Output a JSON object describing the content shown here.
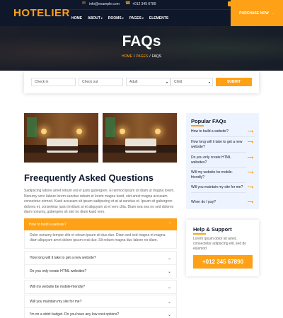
{
  "brand": {
    "logo": "HOTELIER",
    "accent": "#fea116",
    "dark": "#0f172b"
  },
  "topbar": {
    "email_icon": "envelope-icon",
    "email": "info@example.com",
    "phone_icon": "phone-icon",
    "phone": "+012 345 6789"
  },
  "nav": {
    "items": [
      "HOME",
      "ABOUT",
      "ROOMS",
      "PAGES",
      "ELEMENTS"
    ],
    "cta": "PURCHASE NOW"
  },
  "hero": {
    "title": "FAQs",
    "crumbs": [
      "HOME",
      "PAGES",
      "FAQS"
    ]
  },
  "booking": {
    "checkin": "Check in",
    "checkout": "Check out",
    "adult": "Adult",
    "child": "Child",
    "submit": "SUBMIT"
  },
  "faq": {
    "title": "Freequently Asked Questions",
    "intro": "Sadipscing labore amet rebum est et justo gubergren. Et eirmod ipsum sit diam ut magna lorem. Nonumy vero labore lorem sanctus rebum et lorem magna kasd, stet amet magna accusam consetetur eirmod. Kasd accusam sit ipsum sadipscing et at at sanctus et. Ipsum sit gubergren dolores et, consetetur justo invidunt at et aliquyam ut et vero clita. Diam sea sea no sed dolores diam nonumy, gubergren sit stet no diam kasd vero.",
    "active": {
      "question": "How to build a website?",
      "answer": "Dolor nonumy tempor elitr et rebum ipsum sit duo duo. Diam sed sed magna et magna diam aliquyam amet dolore ipsum erat duo. Sit rebum magna duo labore no diam."
    },
    "items": [
      "How long will it take to get a new website?",
      "Do you only create HTML websites?",
      "Will my website be mobile-friendly?",
      "Will you maintain my site for me?",
      "I'm on a strict budget. Do you have any low cost options?"
    ]
  },
  "sidebar": {
    "title": "Popular FAQs",
    "links": [
      "How to build a website?",
      "How long will it take to get a new website?",
      "Do you only create HTML websites?",
      "Will my website be mobile-friendly?",
      "Will you maintain my site for me?",
      "When do I pay?"
    ]
  },
  "help": {
    "title": "Help & Support",
    "text": "Lorem ipsum dolor sit amet, consectetur adipiscing elit, sed do eiusmod",
    "phone": "+012 345 67890"
  }
}
